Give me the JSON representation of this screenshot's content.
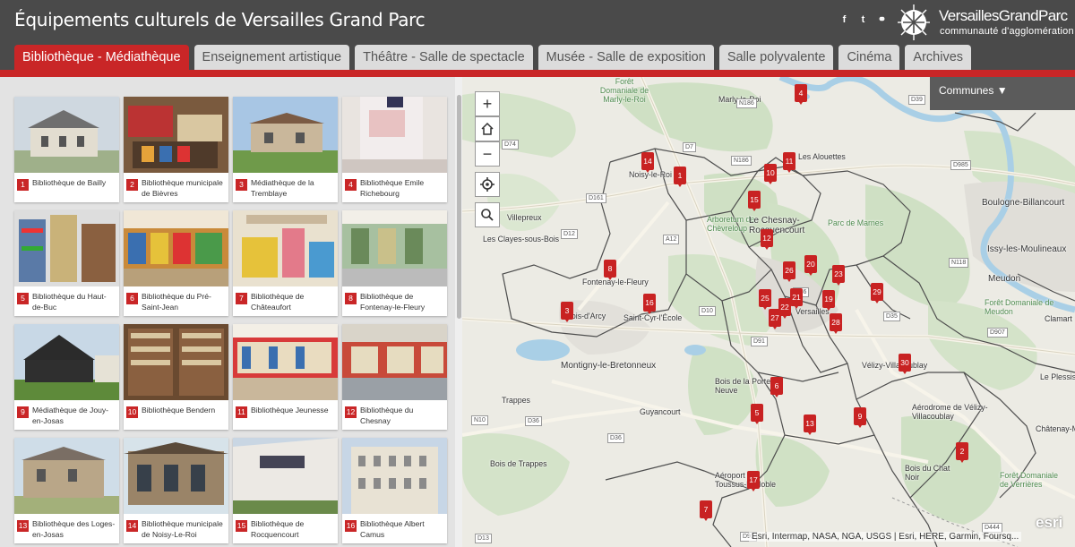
{
  "header": {
    "title": "Équipements culturels de Versailles Grand Parc",
    "logo_name": "VersaillesGrandParc",
    "logo_subtitle": "communauté d'agglomération",
    "social": [
      "facebook-icon",
      "twitter-icon",
      "link-icon"
    ]
  },
  "tabs": [
    {
      "label": "Bibliothèque - Médiathèque",
      "active": true
    },
    {
      "label": "Enseignement artistique",
      "active": false
    },
    {
      "label": "Théâtre - Salle de spectacle",
      "active": false
    },
    {
      "label": "Musée - Salle de exposition",
      "active": false
    },
    {
      "label": "Salle polyvalente",
      "active": false
    },
    {
      "label": "Cinéma",
      "active": false
    },
    {
      "label": "Archives",
      "active": false
    }
  ],
  "gallery": [
    {
      "num": "1",
      "label": "Bibliothèque de Bailly"
    },
    {
      "num": "2",
      "label": "Bibliothèque municipale de Bièvres"
    },
    {
      "num": "3",
      "label": "Médiathèque de la Tremblaye"
    },
    {
      "num": "4",
      "label": "Bibliothèque Emile Richebourg"
    },
    {
      "num": "5",
      "label": "Bibliothèque du Haut-de-Buc"
    },
    {
      "num": "6",
      "label": "Bibliothèque du Pré-Saint-Jean"
    },
    {
      "num": "7",
      "label": "Bibliothèque de Châteaufort"
    },
    {
      "num": "8",
      "label": "Bibliothèque de Fontenay-le-Fleury"
    },
    {
      "num": "9",
      "label": "Médiathèque de Jouy-en-Josas"
    },
    {
      "num": "10",
      "label": "Bibliothèque Bendern"
    },
    {
      "num": "11",
      "label": "Bibliothèque Jeunesse"
    },
    {
      "num": "12",
      "label": "Bibliothèque du Chesnay"
    },
    {
      "num": "13",
      "label": "Bibliothèque des Loges-en-Josas"
    },
    {
      "num": "14",
      "label": "Bibliothèque municipale de Noisy-Le-Roi"
    },
    {
      "num": "15",
      "label": "Bibliothèque de Rocquencourt"
    },
    {
      "num": "16",
      "label": "Bibliothèque Albert Camus"
    }
  ],
  "map": {
    "communes_label": "Communes ▼",
    "attribution": "Esri, Intermap, NASA, NGA, USGS | Esri, HERE, Garmin, Foursq...",
    "esri_logo": "esri",
    "zoom_in": "+",
    "zoom_out": "−",
    "places": [
      "Forêt Domaniale de Marly-le-Roi",
      "Marly-le-Roi",
      "Les Alouettes",
      "Noisy-le-Roi",
      "Villepreux",
      "Les Clayes-sous-Bois",
      "Arboretum de Chèvreloup",
      "Le Chesnay-Rocquencourt",
      "Parc de Marnes",
      "Boulogne-Billancourt",
      "Issy-les-Moulineaux",
      "Fontenay-le-Fleury",
      "Bois-d'Arcy",
      "Saint-Cyr-l'École",
      "Versailles",
      "Meudon",
      "Forêt Domaniale de Meudon",
      "Clamart",
      "Montigny-le-Bretonneux",
      "Vélizy-Villacoublay",
      "Bois de la Porte Neuve",
      "Trappes",
      "Guyancourt",
      "Aérodrome de Vélizy-Villacoublay",
      "Le Plessis-Robinson",
      "Bois de Trappes",
      "Aéroport de Toussus-le-Noble",
      "Bois du Chat Noir",
      "Forêt Domaniale de Verrières",
      "Châtenay-Malabry"
    ],
    "roads": [
      "D74",
      "N186",
      "D7",
      "N186",
      "D161",
      "D12",
      "A12",
      "A86",
      "D10",
      "D91",
      "D35",
      "N10",
      "D36",
      "D36",
      "N118",
      "D39",
      "D985",
      "D13",
      "D444",
      "D91",
      "D907"
    ],
    "markers": [
      "1",
      "2",
      "3",
      "4",
      "5",
      "6",
      "7",
      "8",
      "9",
      "10",
      "11",
      "12",
      "13",
      "14",
      "15",
      "16",
      "17",
      "19",
      "20",
      "21",
      "22",
      "23",
      "25",
      "26",
      "27",
      "28",
      "29",
      "30"
    ]
  },
  "colors": {
    "accent": "#c92627",
    "header_bg": "#4a4a4a",
    "tab_bg": "#dcdcdc"
  }
}
